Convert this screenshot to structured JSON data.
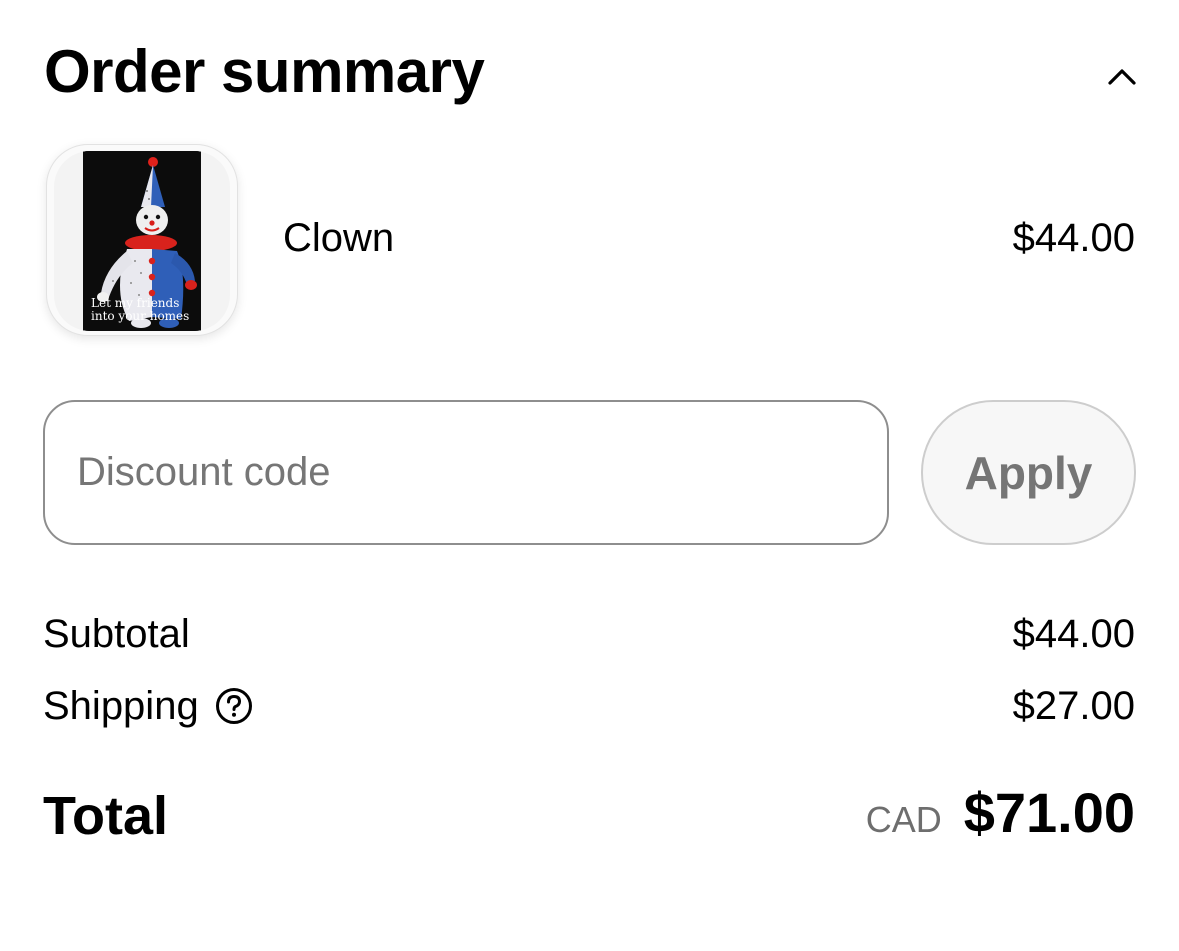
{
  "header": {
    "title": "Order summary",
    "collapse_icon": "chevron-up-icon"
  },
  "line_items": [
    {
      "name": "Clown",
      "price": "$44.00",
      "image_caption": "Let my friends\ninto your homes"
    }
  ],
  "discount": {
    "placeholder": "Discount code",
    "value": "",
    "apply_label": "Apply"
  },
  "totals": {
    "subtotal_label": "Subtotal",
    "subtotal_value": "$44.00",
    "shipping_label": "Shipping",
    "shipping_icon": "help-circle-icon",
    "shipping_value": "$27.00",
    "total_label": "Total",
    "currency": "CAD",
    "total_value": "$71.00"
  },
  "colors": {
    "text": "#000000",
    "muted": "#767676",
    "input_border": "#8e8e8e",
    "button_bg": "#f7f7f7",
    "button_border": "#cdcdcd"
  }
}
